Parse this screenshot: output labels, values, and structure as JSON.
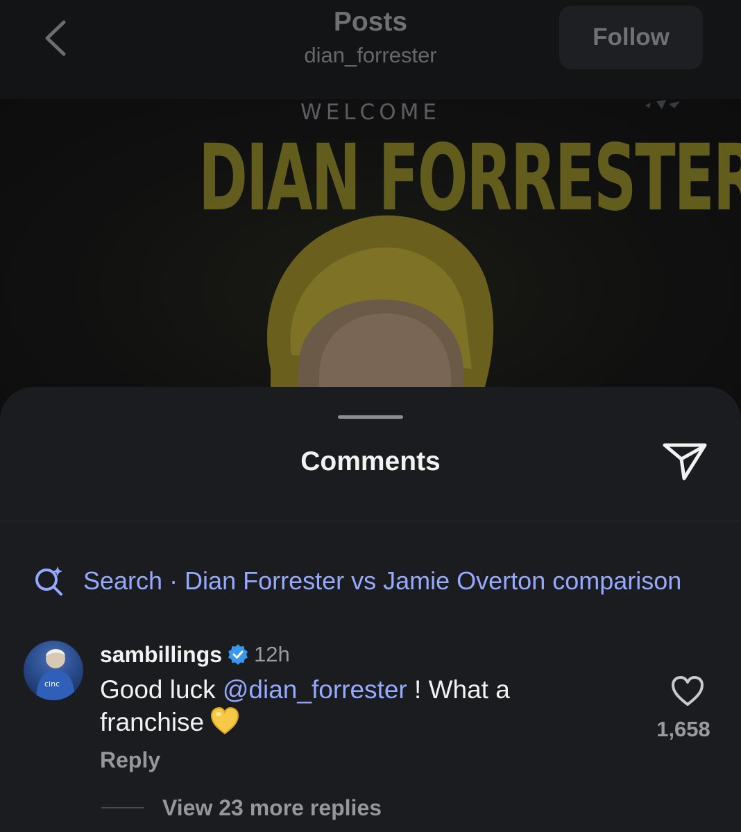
{
  "header": {
    "title": "Posts",
    "username": "dian_forrester",
    "follow_label": "Follow"
  },
  "post": {
    "welcome_text": "WELCOME",
    "name_text": "DIAN FORRESTER"
  },
  "comments_sheet": {
    "title": "Comments",
    "search_suggestion": "Search · Dian Forrester vs Jamie Overton comparison"
  },
  "comment": {
    "username": "sambillings",
    "time": "12h",
    "text_before": "Good luck ",
    "mention": "@dian_forrester",
    "text_after": " ! What a franchise",
    "emoji": "yellow-heart",
    "reply_label": "Reply",
    "like_count": "1,658",
    "view_replies_label": "View 23 more replies"
  },
  "colors": {
    "accent_link": "#95a9ff",
    "sheet_bg": "#1b1c1f",
    "verified_badge": "#3897f0",
    "emoji_heart": "#f7c948"
  }
}
